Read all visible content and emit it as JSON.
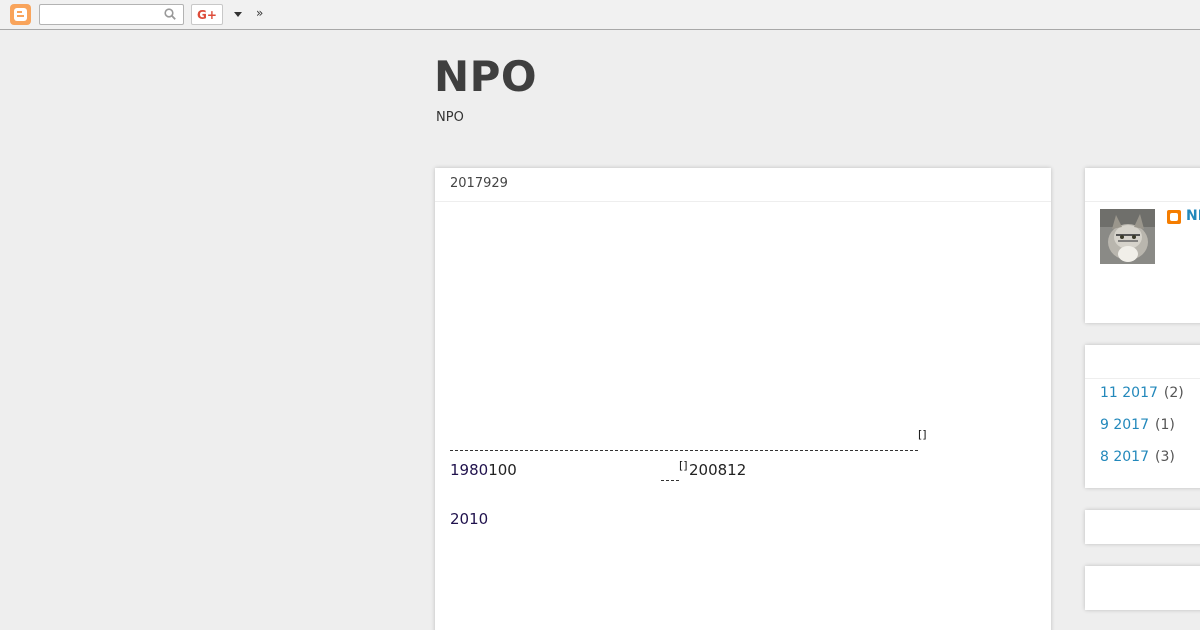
{
  "navbar": {
    "search_value": "",
    "gplus_label": "G+",
    "more_label": "»"
  },
  "header": {
    "title": "NPO",
    "description": "NPO"
  },
  "post": {
    "date": "2017929",
    "footnote_mark_1": "[]",
    "footnote_mark_2": "[]",
    "line1_link": "1980",
    "line1_text": "100",
    "line1_right": "200812",
    "line2_link": "2010"
  },
  "sidebar": {
    "profile_name": "NPO",
    "archive": [
      {
        "label": "11 2017",
        "count": "(2)"
      },
      {
        "label": "9 2017",
        "count": "(1)"
      },
      {
        "label": "8 2017",
        "count": "(3)"
      }
    ]
  },
  "colors": {
    "accent": "#2288bb",
    "background": "#eeeeee",
    "blogger_orange": "#f9a45b"
  }
}
